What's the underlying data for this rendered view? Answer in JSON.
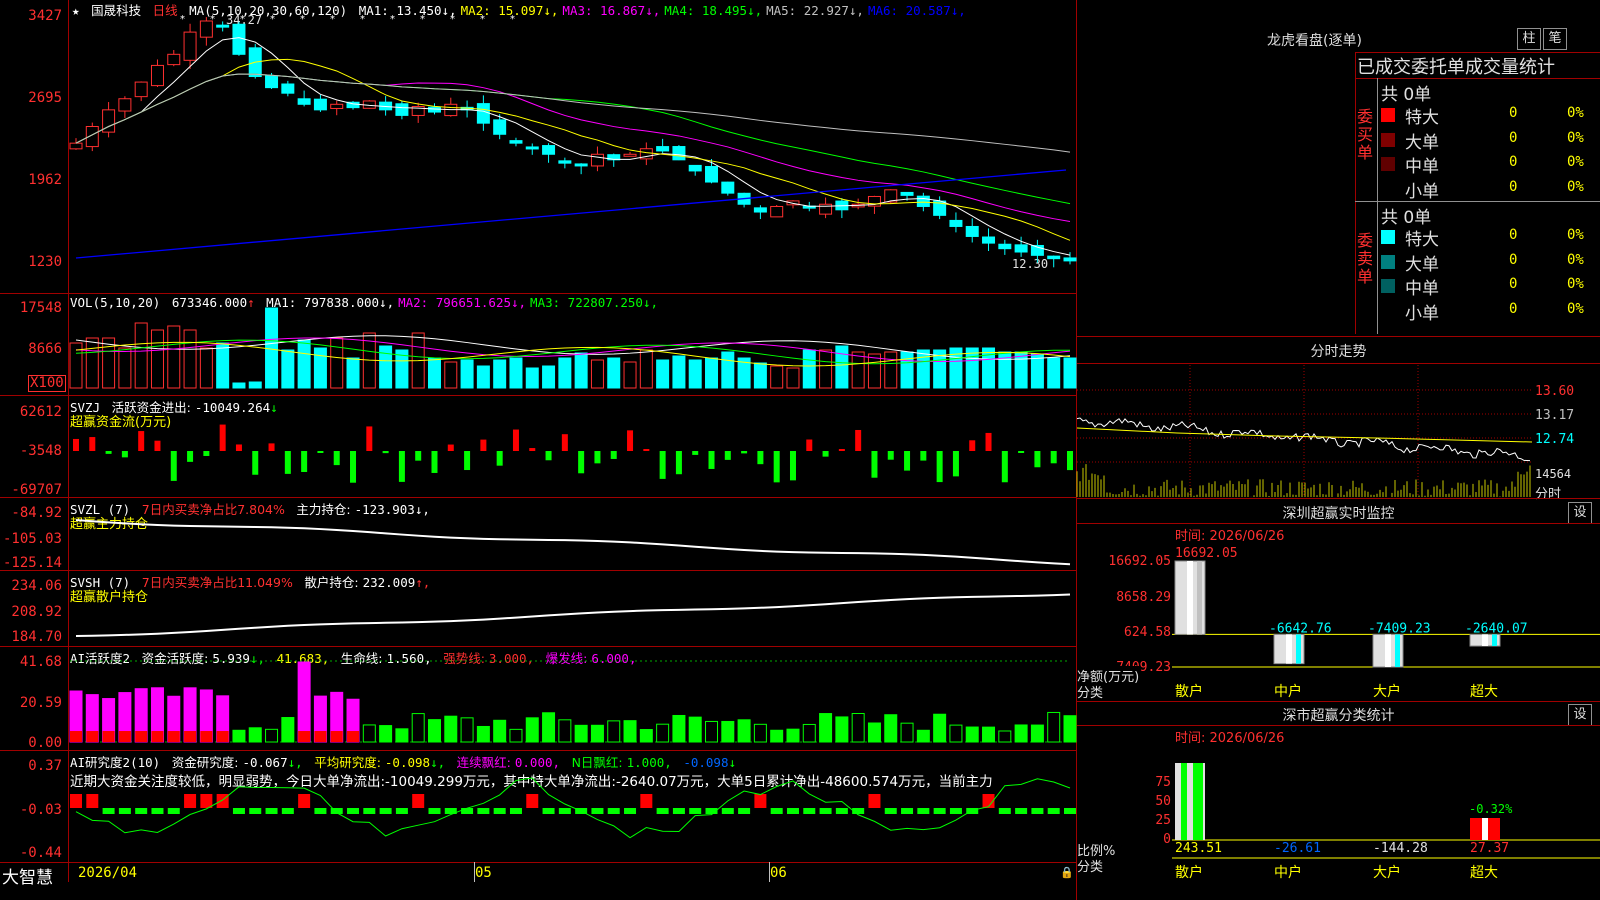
{
  "app": {
    "brand": "大智慧",
    "star": "★",
    "stock_name": "国晟科技",
    "period": "日线"
  },
  "main_panel": {
    "ma_header": "MA(5,10,20,30,60,120)",
    "ma": [
      {
        "label": "MA1:",
        "value": "13.450",
        "arrow": "↓",
        "color": "#ffffff"
      },
      {
        "label": "MA2:",
        "value": "15.097",
        "arrow": "↓",
        "color": "#ffff00"
      },
      {
        "label": "MA3:",
        "value": "16.867",
        "arrow": "↓",
        "color": "#ff00ff"
      },
      {
        "label": "MA4:",
        "value": "18.495",
        "arrow": "↓",
        "color": "#00ff00"
      },
      {
        "label": "MA5:",
        "value": "22.927",
        "arrow": "↓",
        "color": "#c0c0c0"
      },
      {
        "label": "MA6:",
        "value": "20.587",
        "arrow": "↓",
        "color": "#0000ff"
      }
    ],
    "y_ticks": [
      "3427",
      "2695",
      "1962",
      "1230"
    ],
    "high_marker": "34.27",
    "low_marker": "12.30"
  },
  "vol_panel": {
    "header": "VOL(5,10,20)",
    "vol": "673346.000",
    "vol_arrow": "↑",
    "ma": [
      {
        "label": "MA1:",
        "value": "797838.000",
        "arrow": "↓",
        "color": "#ffffff"
      },
      {
        "label": "MA2:",
        "value": "796651.625",
        "arrow": "↓",
        "color": "#ff00ff"
      },
      {
        "label": "MA3:",
        "value": "722807.250",
        "arrow": "↓",
        "color": "#00ff00"
      }
    ],
    "y_ticks": [
      "17548",
      "8666"
    ],
    "unit": "X100"
  },
  "svzj_panel": {
    "code": "SVZJ",
    "label": "活跃资金进出:",
    "value": "-10049.264",
    "arrow": "↓",
    "subtitle": "超赢资金流(万元)",
    "y_ticks": [
      "62612",
      "-3548",
      "-69707"
    ]
  },
  "svzl_panel": {
    "code": "SVZL (7)",
    "label1": "7日内买卖净占比7.804%",
    "label2": "主力持仓:",
    "value": "-123.903",
    "arrow": "↓,",
    "subtitle": "超赢主力持仓",
    "y_ticks": [
      "-84.92",
      "-105.03",
      "-125.14"
    ]
  },
  "svsh_panel": {
    "code": "SVSH (7)",
    "label1": "7日内买卖净占比11.049%",
    "label2": "散户持仓:",
    "value": "232.009",
    "arrow": "↑,",
    "subtitle": "超赢散户持仓",
    "y_ticks": [
      "234.06",
      "208.92",
      "184.70"
    ]
  },
  "ai_active_panel": {
    "code": "AI活跃度2",
    "label": "资金活跃度:",
    "value": "5.939",
    "arrow": "↓,",
    "v2": "41.683,",
    "life_label": "生命线:",
    "life_value": "1.560,",
    "strong_label": "强势线:",
    "strong_value": "3.000,",
    "burst_label": "爆发线:",
    "burst_value": "6.000,",
    "y_ticks": [
      "41.68",
      "20.59",
      "0.00"
    ]
  },
  "ai_research_panel": {
    "code": "AI研究度2(10)",
    "label": "资金研究度:",
    "value": "-0.067",
    "arrow": "↓,",
    "avg_label": "平均研究度:",
    "avg_value": "-0.098",
    "avg_arrow": "↓,",
    "red_label": "连续飘红:",
    "red_value": "0.000,",
    "nred_label": "N日飘红:",
    "nred_value": "1.000,",
    "last_value": "-0.098",
    "last_arrow": "↓",
    "comment": "近期大资金关注度较低，明显弱势，今日大单净流出:-10049.299万元，其中特大单净流出:-2640.07万元，大单5日累计净出-48600.574万元，当前主力",
    "y_ticks": [
      "0.37",
      "-0.03",
      "-0.44"
    ]
  },
  "x_axis": {
    "labels": [
      "2026/04",
      "05",
      "06"
    ]
  },
  "dragon": {
    "title": "龙虎看盘(逐单)",
    "btn1": "柱",
    "btn2": "笔",
    "tabs": [
      "已成交",
      "委托单",
      "成交量统计"
    ],
    "buy_side": "委买单",
    "sell_side": "委卖单",
    "buy_total": "共 0单",
    "sell_total": "共 0单",
    "buy_rows": [
      {
        "label": "特大",
        "count": "0",
        "pct": "0%",
        "color": "#ff0000"
      },
      {
        "label": "大单",
        "count": "0",
        "pct": "0%",
        "color": "#800000"
      },
      {
        "label": "中单",
        "count": "0",
        "pct": "0%",
        "color": "#600000"
      },
      {
        "label": "小单",
        "count": "0",
        "pct": "0%",
        "color": "#000000"
      }
    ],
    "sell_rows": [
      {
        "label": "特大",
        "count": "0",
        "pct": "0%",
        "color": "#00ffff"
      },
      {
        "label": "大单",
        "count": "0",
        "pct": "0%",
        "color": "#008080"
      },
      {
        "label": "中单",
        "count": "0",
        "pct": "0%",
        "color": "#006060"
      },
      {
        "label": "小单",
        "count": "0",
        "pct": "0%",
        "color": "#000000"
      }
    ]
  },
  "intraday": {
    "title": "分时走势",
    "prices": [
      "13.60",
      "13.17",
      "12.74"
    ],
    "vol_label": "14564",
    "unit": "分时"
  },
  "sz_monitor": {
    "title": "深圳超赢实时监控",
    "btn": "设",
    "time": "时间: 2026/06/26",
    "y_ticks": [
      "16692.05",
      "8658.29",
      "624.58",
      "-7409.23"
    ],
    "y_name": "净额(万元)",
    "x_name": "分类",
    "categories": [
      "散户",
      "中户",
      "大户",
      "超大"
    ],
    "values": [
      16692.05,
      -6642.76,
      -7409.23,
      -2640.07
    ],
    "value_labels": [
      "16692.05",
      "-6642.76",
      "-7409.23",
      "-2640.07"
    ]
  },
  "sz_class": {
    "title": "深市超赢分类统计",
    "btn": "设",
    "time": "时间: 2026/06/26",
    "y_ticks": [
      "75",
      "50",
      "25",
      "0"
    ],
    "y_name": "比例%",
    "x_name": "分类",
    "categories": [
      "散户",
      "中户",
      "大户",
      "超大"
    ],
    "bottom_values": [
      "243.51",
      "-26.61",
      "-144.28",
      "27.37"
    ],
    "top_label": "-0.32%"
  },
  "colors": {
    "up": "#ff3030",
    "down": "#00ffff",
    "grid": "#a00000",
    "green": "#00ff00",
    "magenta": "#ff00ff",
    "yellow": "#ffff00"
  }
}
